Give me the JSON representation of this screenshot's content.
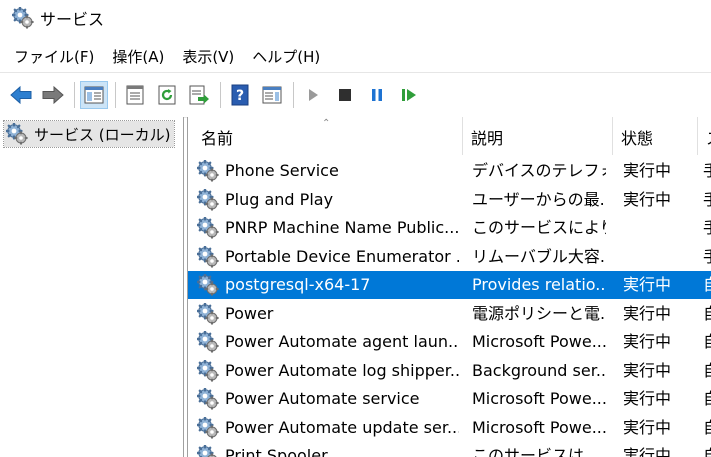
{
  "window": {
    "title": "サービス"
  },
  "menu": [
    "ファイル(F)",
    "操作(A)",
    "表示(V)",
    "ヘルプ(H)"
  ],
  "tree": {
    "node_label": "サービス (ローカル)"
  },
  "columns": {
    "name": "名前",
    "description": "説明",
    "status": "状態",
    "startup": "ス"
  },
  "rows": [
    {
      "name": "Phone Service",
      "description": "デバイスのテレフォ...",
      "status": "実行中",
      "startup": "手"
    },
    {
      "name": "Plug and Play",
      "description": "ユーザーからの最...",
      "status": "実行中",
      "startup": "手"
    },
    {
      "name": "PNRP Machine Name Public...",
      "description": "このサービスにより...",
      "status": "",
      "startup": "手"
    },
    {
      "name": "Portable Device Enumerator ...",
      "description": "リムーバブル大容...",
      "status": "",
      "startup": "手"
    },
    {
      "name": "postgresql-x64-17",
      "description": "Provides relatio...",
      "status": "実行中",
      "startup": "自"
    },
    {
      "name": "Power",
      "description": "電源ポリシーと電...",
      "status": "実行中",
      "startup": "自"
    },
    {
      "name": "Power Automate agent laun...",
      "description": "Microsoft Powe...",
      "status": "実行中",
      "startup": "自"
    },
    {
      "name": "Power Automate log shipper...",
      "description": "Background ser...",
      "status": "実行中",
      "startup": "自"
    },
    {
      "name": "Power Automate service",
      "description": "Microsoft Powe...",
      "status": "実行中",
      "startup": "自"
    },
    {
      "name": "Power Automate update ser...",
      "description": "Microsoft Powe...",
      "status": "実行中",
      "startup": "自"
    },
    {
      "name": "Print Spooler",
      "description": "このサービスは...",
      "status": "実行中",
      "startup": "自"
    }
  ],
  "selected_row": "postgresql-x64-17",
  "colors": {
    "selection": "#0078d7",
    "toolbar_selected": "#cce4f7"
  },
  "toolbar_icons": [
    "back-icon",
    "forward-icon",
    "show-hide-tree-icon",
    "properties-icon",
    "refresh-icon",
    "export-list-icon",
    "help-icon",
    "show-action-pane-icon",
    "start-service-icon",
    "stop-service-icon",
    "pause-service-icon",
    "restart-service-icon"
  ]
}
